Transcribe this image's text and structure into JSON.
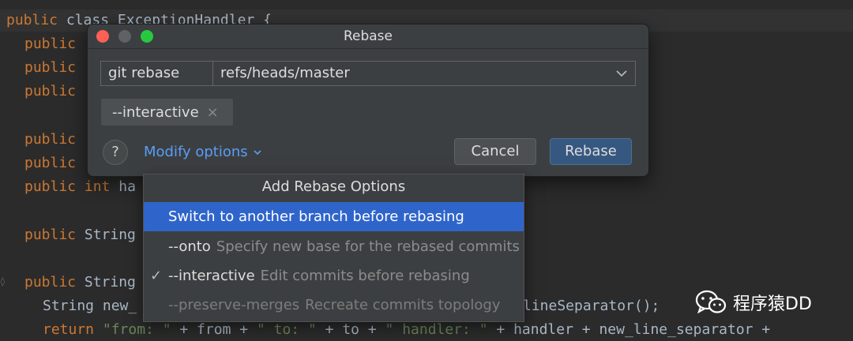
{
  "editor": {
    "lines": [
      {
        "kw": "public",
        "rest": " class ExceptionHandler {"
      },
      {
        "kw": "public",
        "rest": ""
      },
      {
        "kw": "public",
        "rest": ""
      },
      {
        "kw": "public",
        "rest": ""
      },
      {
        "kw": "public",
        "rest": ""
      },
      {
        "kw": "public",
        "rest": ""
      },
      {
        "kw": "public",
        "kw2": "int",
        "rest": " ha"
      },
      {
        "kw": "public",
        "rest": " String"
      },
      {
        "kw": "public",
        "rest": " String"
      },
      {
        "pre": "String new_",
        "tail": "lineSeparator();"
      }
    ],
    "return_line": {
      "kw": "return",
      "s1": "\"from: \"",
      "p1": " + from + ",
      "s2": "\" to: \"",
      "p2": " + to + ",
      "s3": "\" handler: \"",
      "p3": " + handler + new_line_separator +"
    }
  },
  "watermark": {
    "text": "程序猿DD"
  },
  "dialog": {
    "title": "Rebase",
    "command_prefix": "git rebase",
    "branch_value": "refs/heads/master",
    "chip_label": "--interactive",
    "chip_close": "×",
    "help_label": "?",
    "modify_options_label": "Modify options",
    "cancel_label": "Cancel",
    "rebase_label": "Rebase"
  },
  "popup": {
    "header": "Add Rebase Options",
    "items": [
      {
        "option": "Switch to another branch before rebasing",
        "desc": "",
        "checked": false,
        "selected": true,
        "disabled": false
      },
      {
        "option": "--onto",
        "desc": "Specify new base for the rebased commits",
        "checked": false,
        "selected": false,
        "disabled": false
      },
      {
        "option": "--interactive",
        "desc": "Edit commits before rebasing",
        "checked": true,
        "selected": false,
        "disabled": false
      },
      {
        "option": "--preserve-merges",
        "desc": "Recreate commits topology",
        "checked": false,
        "selected": false,
        "disabled": true
      }
    ],
    "check_glyph": "✓"
  },
  "colors": {
    "editor_bg": "#2b2b2b",
    "keyword": "#cc7832",
    "string": "#6a8759",
    "dialog_bg": "#3c3f41",
    "accent_link": "#589df6",
    "selection": "#2f65ca",
    "primary_button": "#365880"
  }
}
